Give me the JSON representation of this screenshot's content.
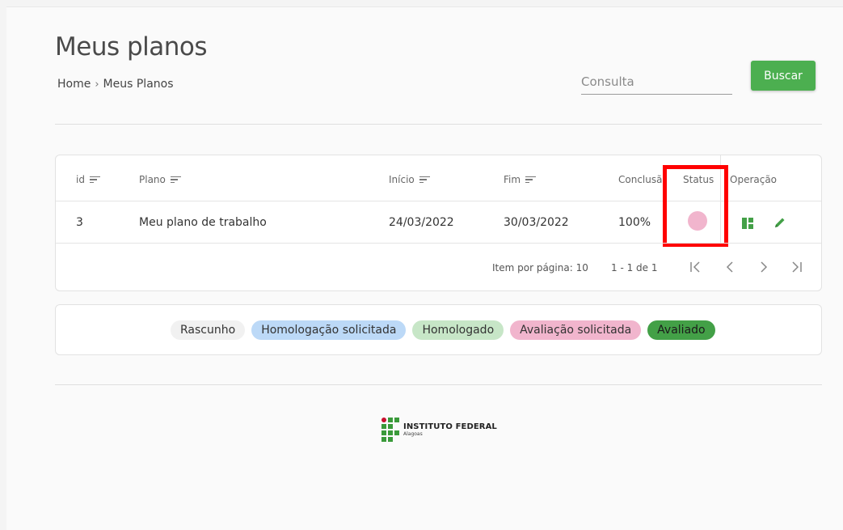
{
  "header": {
    "title": "Meus planos",
    "breadcrumb": [
      "Home",
      "Meus Planos"
    ]
  },
  "search": {
    "placeholder": "Consulta",
    "button_label": "Buscar"
  },
  "table": {
    "columns": [
      "id",
      "Plano",
      "Início",
      "Fim",
      "Conclusão",
      "Status",
      "Operação"
    ],
    "rows": [
      {
        "id": "3",
        "plano": "Meu plano de trabalho",
        "inicio": "24/03/2022",
        "fim": "30/03/2022",
        "conclusao": "100%",
        "status_color": "#f1b5cd"
      }
    ],
    "operations": [
      "layout-icon",
      "edit-pencil-icon"
    ]
  },
  "pagination": {
    "items_per_page_label": "Item por página:",
    "items_per_page_value": "10",
    "range_label": "1 - 1 de 1"
  },
  "legend": [
    {
      "label": "Rascunho",
      "color": "#f1f1f1",
      "text_color": "#333333"
    },
    {
      "label": "Homologação solicitada",
      "color": "#bcd9f7",
      "text_color": "#333333"
    },
    {
      "label": "Homologado",
      "color": "#c7e6c7",
      "text_color": "#333333"
    },
    {
      "label": "Avaliação solicitada",
      "color": "#f1b5cd",
      "text_color": "#333333"
    },
    {
      "label": "Avaliado",
      "color": "#43a047",
      "text_color": "#1b1b1b"
    }
  ],
  "footer": {
    "logo_line1": "INSTITUTO FEDERAL",
    "logo_line2": "Alagoas"
  },
  "colors": {
    "accent": "#4caf50",
    "highlight": "#ff0000"
  }
}
